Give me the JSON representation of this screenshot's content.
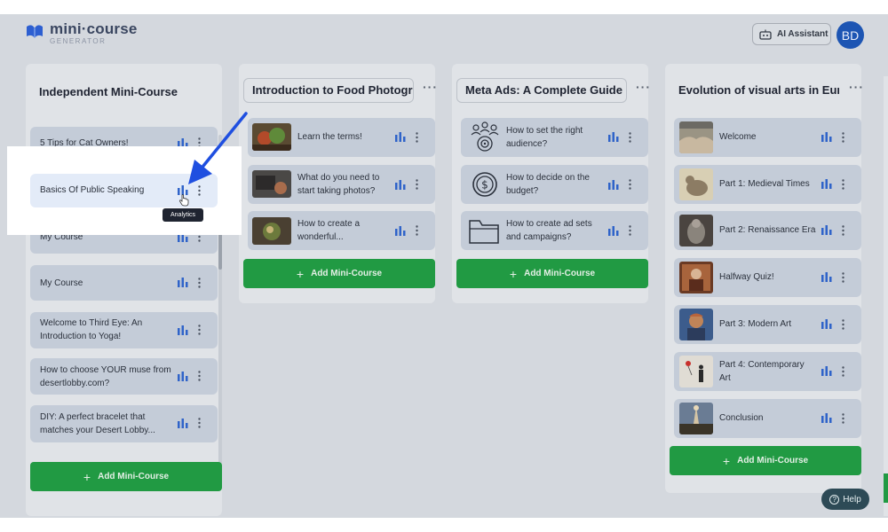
{
  "header": {
    "logo_brand": "mini·course",
    "logo_sub": "GENERATOR",
    "ai_label": "AI Assistant",
    "avatar_initials": "BD"
  },
  "columns": [
    {
      "title": "Independent Mini-Course",
      "items": [
        {
          "label": "5 Tips for Cat Owners!"
        },
        {
          "label": "Basics Of Public Speaking"
        },
        {
          "label": "My Course"
        },
        {
          "label": "My Course"
        },
        {
          "label": "Welcome to Third Eye: An Introduction to Yoga!"
        },
        {
          "label": "How to choose YOUR muse from desertlobby.com?"
        },
        {
          "label": "DIY: A perfect bracelet that matches your Desert Lobby..."
        }
      ],
      "add_label": "Add Mini-Course"
    },
    {
      "title": "Introduction to Food Photogr",
      "items": [
        {
          "label": "Learn the terms!"
        },
        {
          "label": "What do you need to start taking photos?"
        },
        {
          "label": "How to create a wonderful..."
        }
      ],
      "add_label": "Add Mini-Course"
    },
    {
      "title": "Meta Ads: A Complete Guide",
      "items": [
        {
          "label": "How to set the right audience?"
        },
        {
          "label": "How to decide on the budget?"
        },
        {
          "label": "How to create ad sets and campaigns?"
        }
      ],
      "add_label": "Add Mini-Course"
    },
    {
      "title": "Evolution of visual arts in Eur",
      "items": [
        {
          "label": "Welcome"
        },
        {
          "label": "Part 1: Medieval Times"
        },
        {
          "label": "Part 2: Renaissance Era"
        },
        {
          "label": "Halfway Quiz!"
        },
        {
          "label": "Part 3: Modern Art"
        },
        {
          "label": "Part 4: Contemporary Art"
        },
        {
          "label": "Conclusion"
        }
      ],
      "add_label": "Add Mini-Course"
    }
  ],
  "tooltip": "Analytics",
  "help_label": "Help",
  "colors": {
    "accent": "#219a43",
    "primary": "#1d55b3",
    "bars": "#2f63c9",
    "arrow": "#1f4fe0"
  }
}
